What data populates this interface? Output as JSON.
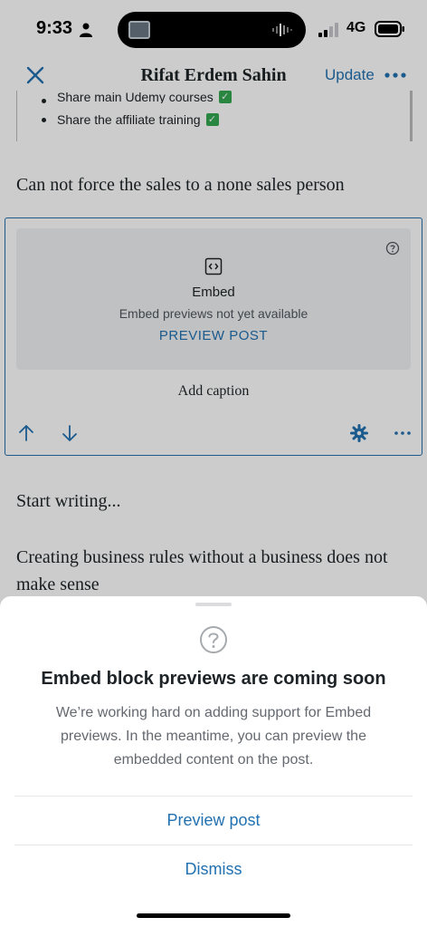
{
  "status": {
    "time": "9:33",
    "network": "4G"
  },
  "nav": {
    "title": "Rifat Erdem Sahin",
    "update_label": "Update"
  },
  "content": {
    "list_items": [
      "Share main Udemy courses",
      "Share the affiliate training"
    ],
    "paragraph1": "Can not force the sales to a none sales person",
    "embed": {
      "label": "Embed",
      "subtitle": "Embed previews not yet available",
      "preview_label": "PREVIEW POST",
      "caption_placeholder": "Add caption"
    },
    "placeholder": "Start writing...",
    "paragraph2": "Creating business rules without a business does not make sense"
  },
  "sheet": {
    "title": "Embed block previews are coming soon",
    "body": "We’re working hard on adding support for Embed previews. In the meantime, you can preview the embedded content on the post.",
    "preview_button": "Preview post",
    "dismiss_button": "Dismiss"
  },
  "colors": {
    "accent": "#2271b1",
    "check_green": "#33a852",
    "text": "#1d2327"
  },
  "icons": [
    "person-icon",
    "signal-icon",
    "battery-icon",
    "close-icon",
    "more-icon",
    "checkbox-icon",
    "help-icon",
    "embed-icon",
    "arrow-up-icon",
    "arrow-down-icon",
    "gear-icon"
  ]
}
